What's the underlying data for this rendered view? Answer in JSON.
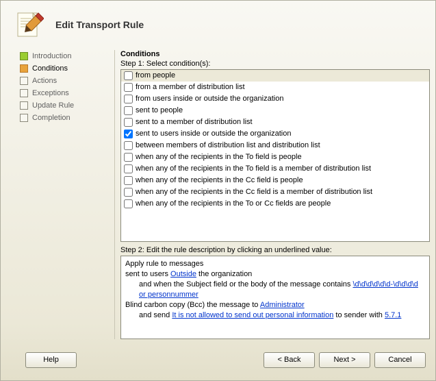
{
  "header": {
    "title": "Edit Transport Rule"
  },
  "sidebar": {
    "items": [
      {
        "label": "Introduction",
        "state": "done"
      },
      {
        "label": "Conditions",
        "state": "current"
      },
      {
        "label": "Actions",
        "state": "pending"
      },
      {
        "label": "Exceptions",
        "state": "pending"
      },
      {
        "label": "Update Rule",
        "state": "pending"
      },
      {
        "label": "Completion",
        "state": "pending"
      }
    ]
  },
  "main": {
    "section_title": "Conditions",
    "step1_label": "Step 1: Select condition(s):",
    "conditions": [
      {
        "label": "from people",
        "checked": false,
        "highlight": true
      },
      {
        "label": "from a member of distribution list",
        "checked": false
      },
      {
        "label": "from users inside or outside the organization",
        "checked": false
      },
      {
        "label": "sent to people",
        "checked": false
      },
      {
        "label": "sent to a member of distribution list",
        "checked": false
      },
      {
        "label": "sent to users inside or outside the organization",
        "checked": true
      },
      {
        "label": "between members of distribution list and distribution list",
        "checked": false
      },
      {
        "label": "when any of the recipients in the To field is people",
        "checked": false
      },
      {
        "label": "when any of the recipients in the To field is a member of distribution list",
        "checked": false
      },
      {
        "label": "when any of the recipients in the Cc field is people",
        "checked": false
      },
      {
        "label": "when any of the recipients in the Cc field is a member of distribution list",
        "checked": false
      },
      {
        "label": "when any of the recipients in the To or Cc fields are people",
        "checked": false
      }
    ],
    "step2_label": "Step 2: Edit the rule description by clicking an underlined value:",
    "description": {
      "line1": "Apply rule to messages",
      "line2_pre": "sent to users ",
      "line2_link": "Outside",
      "line2_post": " the organization",
      "line3_pre": "and when the Subject field or the body of the message contains ",
      "line3_link": "\\d\\d\\d\\d\\d\\d-\\d\\d\\d\\d or personnummer",
      "line4_pre": "Blind carbon copy (Bcc) the message to ",
      "line4_link": "Administrator",
      "line5_pre": "and send ",
      "line5_link": "It is not allowed to send out personal information",
      "line5_mid": " to sender with ",
      "line5_link2": "5.7.1"
    }
  },
  "footer": {
    "help": "Help",
    "back": "< Back",
    "next": "Next >",
    "cancel": "Cancel"
  }
}
